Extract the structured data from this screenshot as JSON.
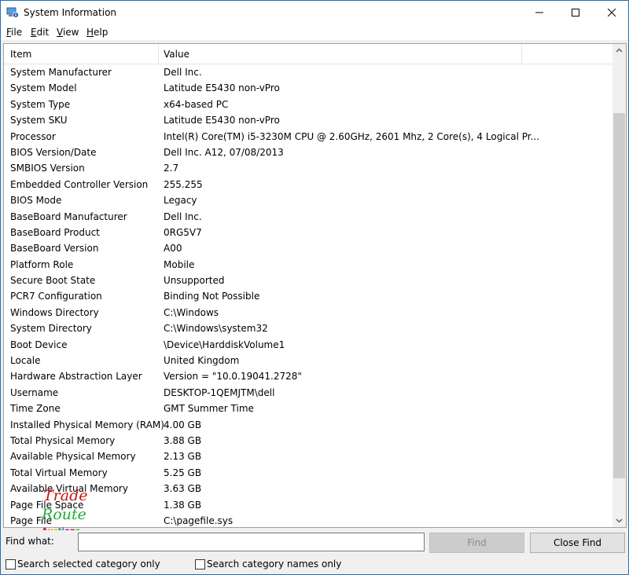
{
  "window": {
    "title": "System Information",
    "icon": "system-information-icon",
    "controls": [
      "minimize-icon",
      "maximize-icon",
      "close-icon"
    ]
  },
  "menu": [
    {
      "label": "File"
    },
    {
      "label": "Edit"
    },
    {
      "label": "View"
    },
    {
      "label": "Help"
    }
  ],
  "table": {
    "columns": [
      "Item",
      "Value"
    ],
    "rows": [
      {
        "item": "System Manufacturer",
        "value": "Dell Inc."
      },
      {
        "item": "System Model",
        "value": "Latitude E5430 non-vPro"
      },
      {
        "item": "System Type",
        "value": "x64-based PC"
      },
      {
        "item": "System SKU",
        "value": "Latitude E5430 non-vPro"
      },
      {
        "item": "Processor",
        "value": "Intel(R) Core(TM) i5-3230M CPU @ 2.60GHz, 2601 Mhz, 2 Core(s), 4 Logical Pr..."
      },
      {
        "item": "BIOS Version/Date",
        "value": "Dell Inc. A12, 07/08/2013"
      },
      {
        "item": "SMBIOS Version",
        "value": "2.7"
      },
      {
        "item": "Embedded Controller Version",
        "value": "255.255"
      },
      {
        "item": "BIOS Mode",
        "value": "Legacy"
      },
      {
        "item": "BaseBoard Manufacturer",
        "value": "Dell Inc."
      },
      {
        "item": "BaseBoard Product",
        "value": "0RG5V7"
      },
      {
        "item": "BaseBoard Version",
        "value": "A00"
      },
      {
        "item": "Platform Role",
        "value": "Mobile"
      },
      {
        "item": "Secure Boot State",
        "value": "Unsupported"
      },
      {
        "item": "PCR7 Configuration",
        "value": "Binding Not Possible"
      },
      {
        "item": "Windows Directory",
        "value": "C:\\Windows"
      },
      {
        "item": "System Directory",
        "value": "C:\\Windows\\system32"
      },
      {
        "item": "Boot Device",
        "value": "\\Device\\HarddiskVolume1"
      },
      {
        "item": "Locale",
        "value": "United Kingdom"
      },
      {
        "item": "Hardware Abstraction Layer",
        "value": "Version = \"10.0.19041.2728\""
      },
      {
        "item": "Username",
        "value": "DESKTOP-1QEMJTM\\dell"
      },
      {
        "item": "Time Zone",
        "value": "GMT Summer Time"
      },
      {
        "item": "Installed Physical Memory (RAM)",
        "value": "4.00 GB"
      },
      {
        "item": "Total Physical Memory",
        "value": "3.88 GB"
      },
      {
        "item": "Available Physical Memory",
        "value": "2.13 GB"
      },
      {
        "item": "Total Virtual Memory",
        "value": "5.25 GB"
      },
      {
        "item": "Available Virtual Memory",
        "value": "3.63 GB"
      },
      {
        "item": "Page File Space",
        "value": "1.38 GB"
      },
      {
        "item": "Page File",
        "value": "C:\\pagefile.sys"
      }
    ]
  },
  "find": {
    "label": "Find what:",
    "value": "",
    "find_button": "Find",
    "close_button": "Close Find",
    "option1": "Search selected category only",
    "option2": "Search category names only"
  },
  "watermark": {
    "line1": "Trade",
    "line2": "Route",
    "line3": "Auctions",
    "colors": {
      "trade": "#cc1111",
      "route": "#22aa33",
      "auctions": [
        "#cc1111",
        "#e07a10",
        "#d4b000",
        "#22aa33",
        "#1a5fd0",
        "#7a22b0",
        "#cc1111",
        "#22aa33"
      ]
    }
  }
}
